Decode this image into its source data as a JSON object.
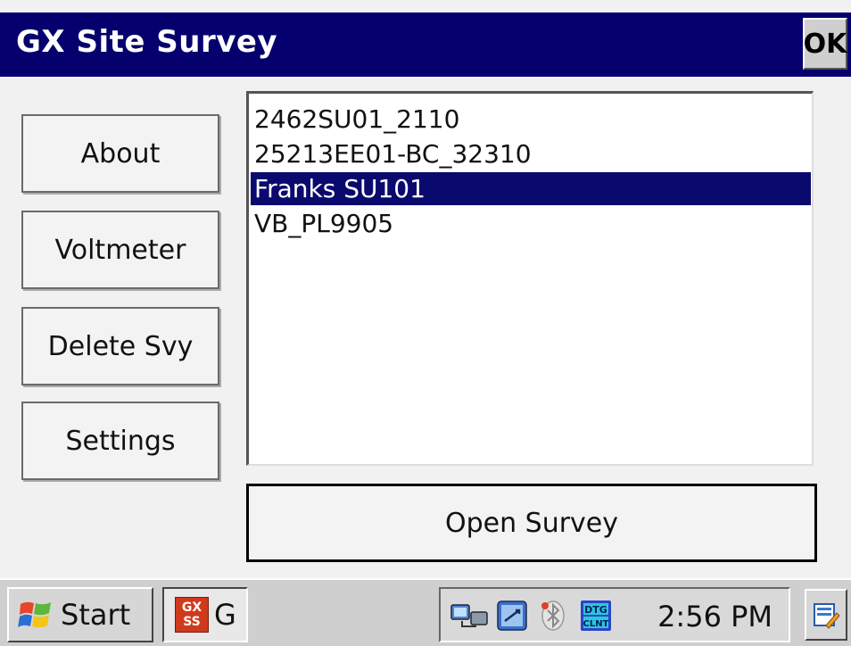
{
  "window": {
    "title": "GX Site Survey",
    "ok_label": "OK"
  },
  "sidebar": {
    "buttons": [
      {
        "label": "About"
      },
      {
        "label": "Voltmeter"
      },
      {
        "label": "Delete Svy"
      },
      {
        "label": "Settings"
      }
    ]
  },
  "survey_list": {
    "items": [
      "2462SU01_2110",
      "25213EE01-BC_32310",
      "Franks SU101",
      "VB_PL9905"
    ],
    "selected": "Franks SU101"
  },
  "open_button": {
    "label": "Open Survey"
  },
  "taskbar": {
    "start_label": "Start",
    "app_icon_text": [
      "GX",
      "SS"
    ],
    "app_label": "G",
    "clock": "2:56 PM",
    "tray_icons": [
      "network-icon",
      "sync-icon",
      "bluetooth-icon",
      "dtg-client-icon"
    ],
    "accent": "#06006e"
  }
}
